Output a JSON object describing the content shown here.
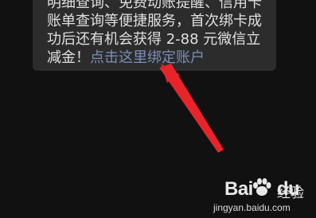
{
  "message": {
    "lines": [
      "明细查询、免费动账提醒、信用卡",
      "账单查询等便捷服务，首次绑卡成",
      "功后还有机会获得 2-88 元微信立"
    ],
    "last_line_text": "减金！",
    "link_text": "点击这里绑定账户"
  },
  "annotation": {
    "arrow_color": "#e8242a"
  },
  "watermark": {
    "logo_text": "Bai",
    "logo_suffix": "du",
    "label": "经验",
    "url": "jingyan.baidu.com"
  }
}
